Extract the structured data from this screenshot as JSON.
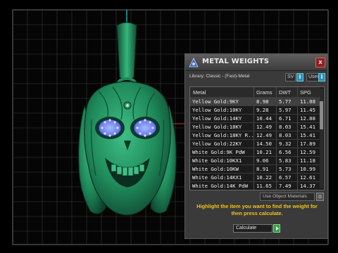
{
  "panel": {
    "title": "METAL WEIGHTS",
    "close_glyph": "x",
    "icon": "metal-weights-icon",
    "library_label": "Library: Classic - (Fast)-Metal",
    "toggles": [
      {
        "label": "SV",
        "box": "i"
      },
      {
        "label": "User",
        "box": "i"
      }
    ],
    "table": {
      "columns": [
        "Metal",
        "Grams",
        "DWT",
        "SPG"
      ],
      "rows": [
        [
          "Yellow Gold:9KY",
          "8.98",
          "5.77",
          "11.08"
        ],
        [
          "Yellow Gold:10KY",
          "9.28",
          "5.97",
          "11.45"
        ],
        [
          "Yellow Gold:14KY",
          "10.44",
          "6.71",
          "12.88"
        ],
        [
          "Yellow Gold:18KY",
          "12.49",
          "8.03",
          "15.41"
        ],
        [
          "Yellow Gold:18KY R...",
          "12.49",
          "8.03",
          "15.41"
        ],
        [
          "Yellow Gold:22KY",
          "14.50",
          "9.32",
          "17.89"
        ],
        [
          "White Gold:9K PdW",
          "10.21",
          "6.56",
          "12.59"
        ],
        [
          "White Gold:10KX1",
          "9.06",
          "5.83",
          "11.18"
        ],
        [
          "White Gold:10KW",
          "8.91",
          "5.73",
          "10.99"
        ],
        [
          "White Gold:14KX1",
          "10.22",
          "6.57",
          "12.61"
        ],
        [
          "White Gold:14K PdW",
          "11.65",
          "7.49",
          "14.37"
        ]
      ]
    },
    "use_object_materials_label": "Use Object Materials",
    "use_object_materials_box": "o",
    "hint": "Highlight the item you want to find the weight for then press calculate.",
    "calculate_label": "Calculate",
    "colors": {
      "hint": "#f0c419",
      "toggle_blue": "#2a8fb0",
      "calculate_green": "#2aa33a",
      "model_green": "#1f8a5a"
    }
  }
}
